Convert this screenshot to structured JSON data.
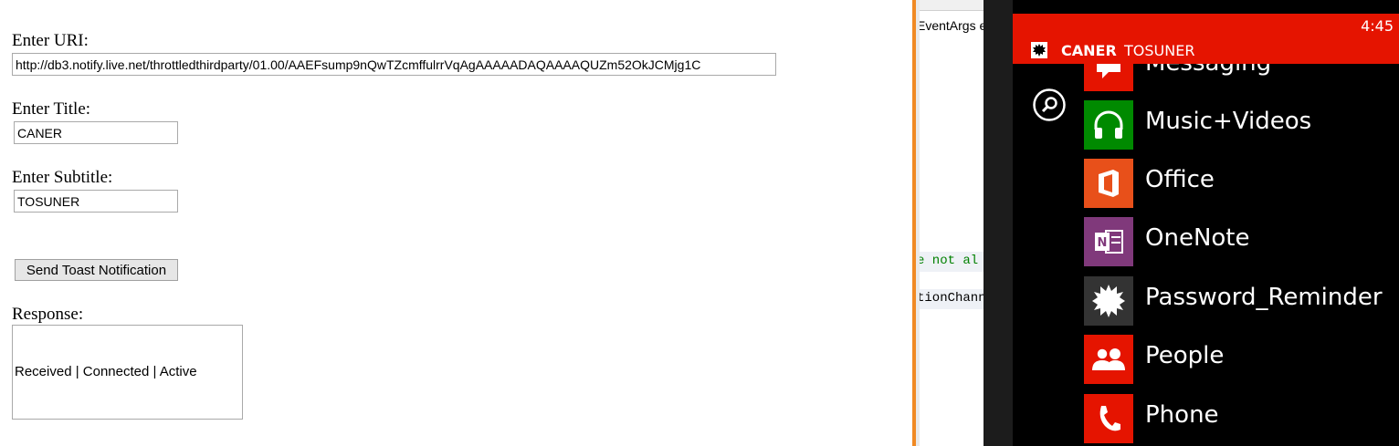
{
  "form": {
    "uri_label": "Enter URI:",
    "uri_value": "http://db3.notify.live.net/throttledthirdparty/01.00/AAEFsump9nQwTZcmffulrrVqAgAAAAADAQAAAAQUZm52OkJCMjg1C",
    "title_label": "Enter Title:",
    "title_value": "CANER",
    "subtitle_label": "Enter Subtitle:",
    "subtitle_value": "TOSUNER",
    "send_label": "Send Toast Notification",
    "response_label": "Response:",
    "response_text": "Received | Connected | Active"
  },
  "ide": {
    "line1": "EventArgs e",
    "line2": "e not al",
    "line3": "tionChann"
  },
  "phone": {
    "time": "4:45",
    "toast_title": "CANER",
    "toast_subtitle": "TOSUNER",
    "apps": [
      {
        "label": "Messaging",
        "color": "#e51400",
        "icon": "messaging-icon"
      },
      {
        "label": "Music+Videos",
        "color": "#008a00",
        "icon": "headphones-icon"
      },
      {
        "label": "Office",
        "color": "#e8501a",
        "icon": "office-icon"
      },
      {
        "label": "OneNote",
        "color": "#80397b",
        "icon": "onenote-icon"
      },
      {
        "label": "Password_Reminder",
        "color": "#333333",
        "icon": "starburst-icon"
      },
      {
        "label": "People",
        "color": "#e51400",
        "icon": "people-icon"
      },
      {
        "label": "Phone",
        "color": "#e51400",
        "icon": "phone-icon"
      }
    ]
  }
}
